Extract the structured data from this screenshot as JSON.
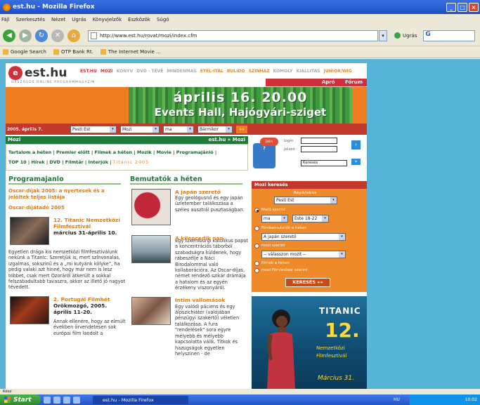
{
  "window": {
    "title": "est.hu - Mozilla Firefox"
  },
  "menu": [
    "Fájl",
    "Szerkesztés",
    "Nézet",
    "Ugrás",
    "Könyvjelzők",
    "Eszközök",
    "Súgó"
  ],
  "nav": {
    "url": "http://www.est.hu/rovat/mozi/index.cfm",
    "go_label": "Ugrás",
    "search_text": "G"
  },
  "bookmarks": [
    "Google Search",
    "OTP Bank Rt.",
    "The Internet Movie ..."
  ],
  "site": {
    "logo": "est.hu",
    "tagline": "ORSZÁGOS ONLINE PROGRAMMAGAZIN",
    "topnav": [
      "EST.HU",
      "MOZI",
      "KONYV",
      "DVD - TÉVÉ",
      "MINDENMAS",
      "ETEL-ITAL",
      "BULIDO",
      "SZINHAZ",
      "KOMOLY",
      "KIALLITAS",
      "JUNIOR/WIG"
    ],
    "subnav": [
      "Apró",
      "Fórum"
    ],
    "banner": {
      "line1": "április 16. 20.00",
      "line2": "Events Hall, Hajógyári-sziget"
    },
    "searchbar": {
      "date": "2005. április 7.",
      "city": "Pesti Est",
      "category": "Mozi",
      "day": "ma",
      "time": "Bármikor"
    },
    "section_title": "Mozi",
    "section_crumb": "est.hu » Mozi",
    "tabs_line1": "Tartalom a héten | Premier előtt | Filmek a héten | Mozik | Movie | Programajánló |",
    "tabs_line2": "TOP 10 | Hírek | DVD | Filmtár | Interjúk |",
    "tabs_tag": "Titanic 2005",
    "col1": {
      "heading": "Programajanlo",
      "link1": "Oscar-díjak 2005: a nyertesek és a jelöltek teljes listája",
      "link2": "Oscar-díjátadó 2005",
      "item1_title": "12. Titanic Nemzetközi Filmfesztivál",
      "item1_date": "március 31-április 10.",
      "item1_text": "Egyetlen drága kis nemzetközi filmfesztiválunk nekünk a Titanic. Szeretjük is, mert színvonalas, izgalmas, sokszínű és a „mi kutyánk kölyke”, ha pedig valaki azt hinné, hogy már nem is lesz többet, csak mert Ozoráról átkerült a sokkal felszabadultabb tavaszra, akkor az illető jó nagyot tévedett.",
      "item2_title": "2. Portugál Filmhét",
      "item2_subtitle": "Orökmozgó, 2005. április 11-20.",
      "item2_text": "Annak ellenére, hogy az elmúlt években örvendetesen sok európai film landolt a"
    },
    "col2": {
      "heading": "Bemutatók a héten",
      "item1_title": "A japán szerető",
      "item1_text": "Egy geológusnő és egy japán üzletember találkozása a széles ausztrál pusztaságban.",
      "item2_title": "A kilencedik nap",
      "item2_text": "Egy luxemburgi katolikus papot a koncentrációs táborból szabadságra küldenek, hogy rábeszélje a Náci Birodalommal való kollaborációra. Az Oscar-díjas, német rendező szikár drámája a hatalom és az egyén érzékeny viszonyáról.",
      "item3_title": "Intim vallomások",
      "item3_text": "Egy valódi páciens és egy álpszichiáter (valójában pénzügyi szakértő) véletlen találkozása. A fura \"rendelések\" sora egyre mélyebb és mélyebb kapcsolatta válik. Titkok és hazugságok egyetlen helyszínen - de"
    },
    "login": {
      "badge": "Join",
      "login_label": "login",
      "password_label": "jelszó",
      "search_value": "Keresés"
    },
    "mozi_kereso": {
      "title": "Mozi keresés",
      "region_label": "Régió/város",
      "region_value": "Pesti Est",
      "option1": "Ma(i) szerint",
      "day_value": "ma",
      "time_value": "Este 18-22",
      "option2": "Filmbemutatók a héten",
      "film_value": "A japán szerető",
      "option3": "mozi szerint",
      "cinema_value": "-- válasszon mozit --",
      "option4": "filmek a héten",
      "option5": "mozi Film/műsor szerint",
      "button": "KERESÉS »»"
    },
    "titanic_ad": {
      "title": "TITANIC",
      "number": "12.",
      "line1": "Nemzetközi",
      "line2": "Filmfesztivál",
      "date": "Március 31."
    }
  },
  "status": "Kész",
  "taskbar": {
    "start": "Start",
    "task": "est.hu - Mozilla Firefox",
    "lang": "HU",
    "clock": "10:02"
  }
}
